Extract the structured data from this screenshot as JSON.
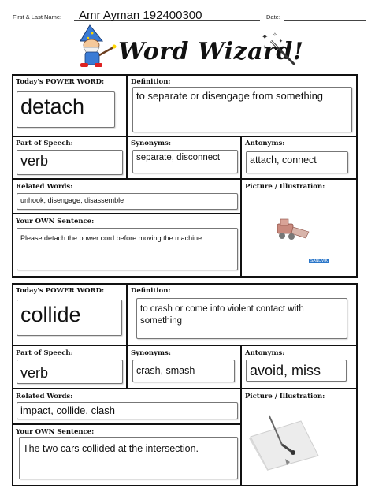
{
  "header": {
    "name_label": "First & Last Name:",
    "name_value": "Amr Ayman 192400300",
    "date_label": "Date:",
    "title": "Word Wizard!"
  },
  "labels": {
    "power_word": "Today's POWER WORD:",
    "definition": "Definition:",
    "part_of_speech": "Part of Speech:",
    "synonyms": "Synonyms:",
    "antonyms": "Antonyms:",
    "related_words": "Related Words:",
    "picture": "Picture / Illustration:",
    "own_sentence": "Your OWN Sentence:"
  },
  "cards": [
    {
      "power_word": "detach",
      "definition": "to separate or disengage from something",
      "part_of_speech": "verb",
      "synonyms": "separate, disconnect",
      "antonyms": "attach, connect",
      "related_words": "unhook, disengage, disassemble",
      "sentence": "Please detach the power cord before moving the machine.",
      "picture_caption": "SANDVIK"
    },
    {
      "power_word": "collide",
      "definition": "to crash or come into violent contact with something",
      "part_of_speech": "verb",
      "synonyms": "crash, smash",
      "antonyms": "avoid, miss",
      "related_words": "impact, collide, clash",
      "sentence": "The two cars collided at the intersection."
    }
  ]
}
